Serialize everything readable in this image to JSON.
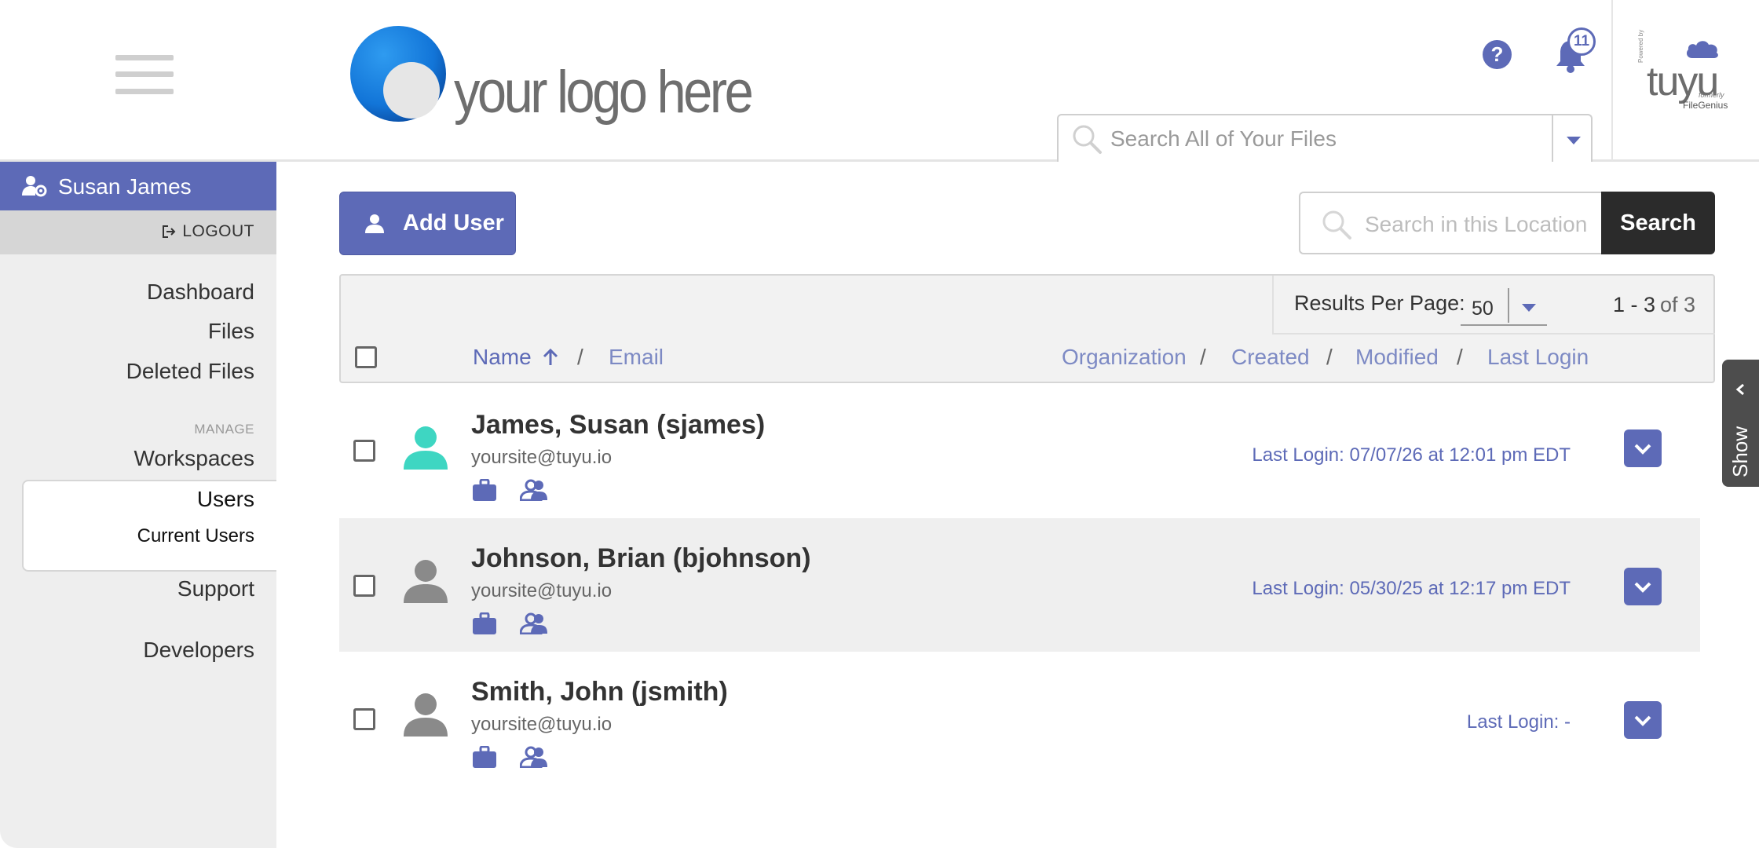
{
  "colors": {
    "accent": "#5d6ab7",
    "sidebar_bg": "#eeeeee",
    "avatar_active": "#3ed6c2",
    "avatar_default": "#8a8a8a"
  },
  "header": {
    "logo_text": "your logo here",
    "help_icon": "help-icon",
    "notifications": {
      "icon": "bell-icon",
      "count": "11"
    },
    "brand": {
      "name": "tuyu",
      "powered_by": "Powered by",
      "formerly": "formerly",
      "former_name": "FileGenius"
    },
    "global_search": {
      "placeholder": "Search All of Your Files"
    }
  },
  "sidebar": {
    "user_name": "Susan James",
    "logout_label": "LOGOUT",
    "items": [
      {
        "label": "Dashboard"
      },
      {
        "label": "Files"
      },
      {
        "label": "Deleted Files"
      }
    ],
    "manage_section": "MANAGE",
    "manage_items": [
      {
        "label": "Workspaces"
      },
      {
        "label": "Users"
      },
      {
        "label": "Current Users"
      }
    ],
    "bottom_items": [
      {
        "label": "Support"
      },
      {
        "label": "Developers"
      }
    ]
  },
  "toolbar": {
    "add_user_label": "Add User",
    "location_search_placeholder": "Search in this Location",
    "search_label": "Search"
  },
  "table": {
    "results_per_page_label": "Results Per Page:",
    "results_per_page_value": "50",
    "range": "1 - 3",
    "total": "of 3",
    "columns": {
      "name": "Name",
      "email": "Email",
      "organization": "Organization",
      "created": "Created",
      "modified": "Modified",
      "last_login": "Last Login"
    },
    "separator": "/",
    "rows": [
      {
        "name": "James, Susan (sjames)",
        "email": "yoursite@tuyu.io",
        "last_login": "Last Login: 07/07/26 at 12:01 pm EDT"
      },
      {
        "name": "Johnson, Brian (bjohnson)",
        "email": "yoursite@tuyu.io",
        "last_login": "Last Login: 05/30/25 at 12:17 pm EDT"
      },
      {
        "name": "Smith, John (jsmith)",
        "email": "yoursite@tuyu.io",
        "last_login": "Last Login: -"
      }
    ]
  },
  "side_panel": {
    "show_label": "Show"
  }
}
